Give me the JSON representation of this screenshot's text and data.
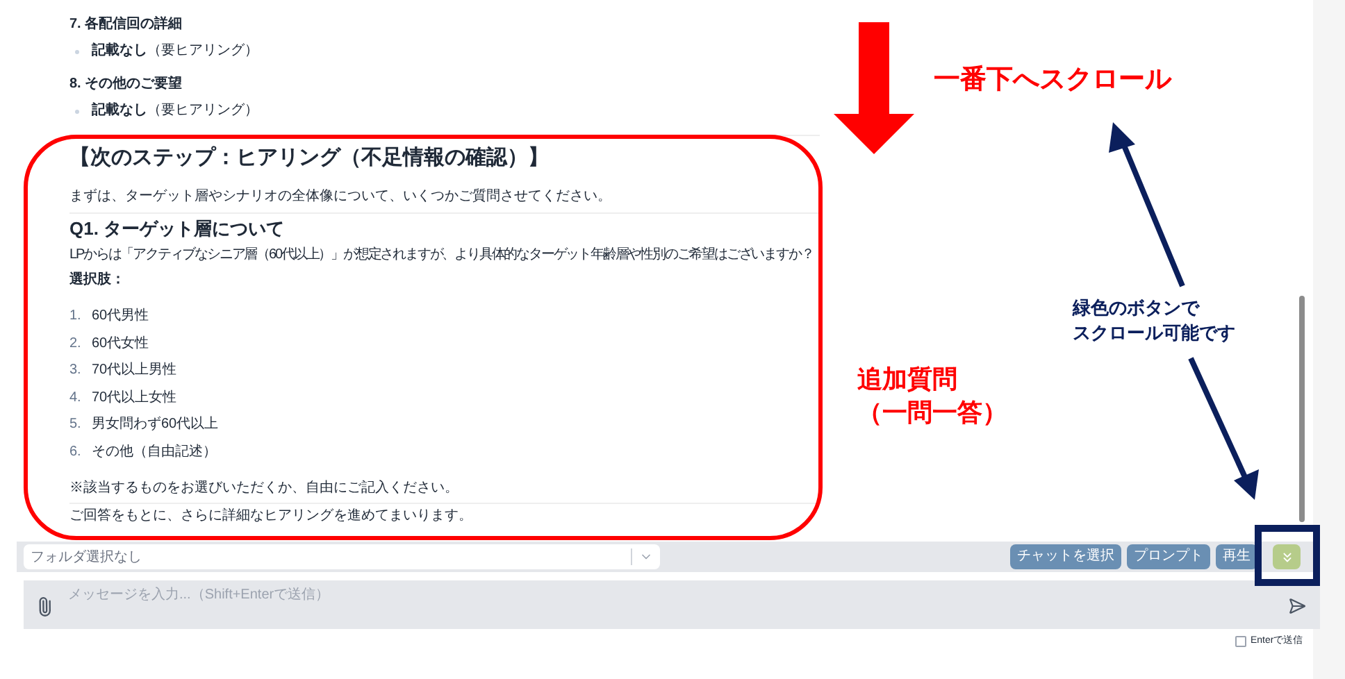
{
  "sections": [
    {
      "heading": "7. 各配信回の詳細",
      "bullets": [
        "**記載なし**（要ヒアリング）"
      ]
    },
    {
      "heading": "8. その他のご要望",
      "bullets": [
        "**記載なし**（要ヒアリング）"
      ]
    }
  ],
  "hearing": {
    "title": "【次のステップ：ヒアリング（不足情報の確認）】",
    "intro": "まずは、ターゲット層やシナリオの全体像について、いくつかご質問させてください。",
    "question": "Q1. ターゲット層について",
    "question_text": "LPからは「アクティブなシニア層（60代以上）」が想定されますが、より具体的なターゲット年齢層や性別のご希望はございますか？",
    "choices_label": "選択肢：",
    "choices": [
      {
        "number": "1.",
        "text": "60代男性"
      },
      {
        "number": "2.",
        "text": "60代女性"
      },
      {
        "number": "3.",
        "text": "70代以上男性"
      },
      {
        "number": "4.",
        "text": "70代以上女性"
      },
      {
        "number": "5.",
        "text": "男女問わず60代以上"
      },
      {
        "number": "6.",
        "text": "その他（自由記述）"
      }
    ],
    "note": "※該当するものをお選びいただくか、自由にご記入ください。",
    "closing": "ご回答をもとに、さらに詳細なヒアリングを進めてまいります。"
  },
  "composer": {
    "folder_select": {
      "value": "フォルダ選択なし"
    },
    "buttons": [
      "チャットを選択",
      "プロンプト",
      "再生"
    ],
    "message": {
      "placeholder": "メッセージを入力...（Shift+Enterで送信）"
    },
    "enter_to_send": {
      "label": "Enterで送信",
      "checked": false
    }
  },
  "annotations": {
    "scroll_label": "一番下へスクロール",
    "button_note": [
      "緑色のボタンで",
      "スクロール可能です"
    ],
    "question_label": [
      "追加質問",
      "（一問一答）"
    ]
  }
}
